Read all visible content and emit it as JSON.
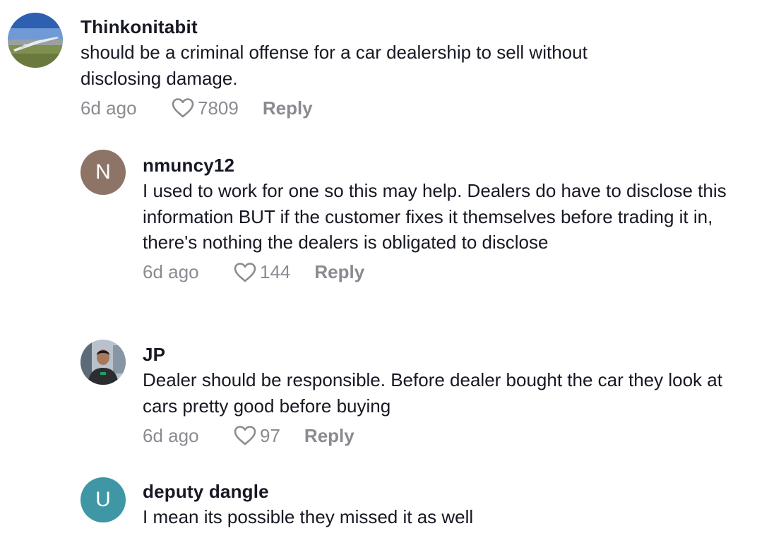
{
  "comments": [
    {
      "username": "Thinkonitabit",
      "text": "should be a criminal offense for a car dealership to sell without disclosing damage.",
      "time": "6d ago",
      "likes": "7809",
      "reply_label": "Reply",
      "avatar": {
        "type": "photo",
        "description_icon": "landscape-photo-avatar"
      }
    },
    {
      "username": "nmuncy12",
      "text": "I used to work for one so this may help. Dealers do have to disclose this information BUT if the customer fixes it themselves before trading it in, there's nothing the dealers is obligated to disclose",
      "time": "6d ago",
      "likes": "144",
      "reply_label": "Reply",
      "avatar": {
        "type": "initial",
        "initial": "N",
        "color": "#8d7467"
      }
    },
    {
      "username": "JP",
      "text": "Dealer should be responsible. Before dealer bought the car they look at cars pretty good before buying",
      "time": "6d ago",
      "likes": "97",
      "reply_label": "Reply",
      "avatar": {
        "type": "photo",
        "description_icon": "person-photo-avatar"
      }
    },
    {
      "username": "deputy dangle",
      "text": "I mean its possible they missed it as well",
      "avatar": {
        "type": "initial",
        "initial": "U",
        "color": "#3f97a5"
      }
    }
  ],
  "colors": {
    "text": "#161823",
    "meta": "#8a8b91"
  },
  "icons": {
    "like": "heart-outline-icon"
  }
}
